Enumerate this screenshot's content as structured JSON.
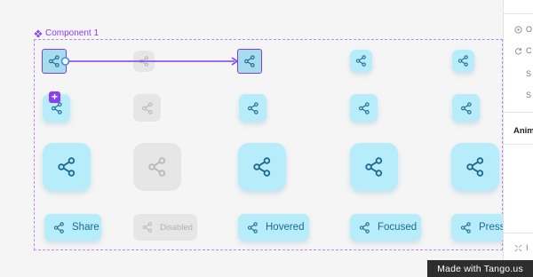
{
  "component": {
    "label": "Component 1"
  },
  "buttons": {
    "share": "Share",
    "disabled": "Disabled",
    "hovered": "Hovered",
    "focused": "Focused",
    "pressed": "Pressed"
  },
  "panel": {
    "row1": "O",
    "row2": "C",
    "row3": "S",
    "row4": "S",
    "animation": "Anim",
    "bottom": "I"
  },
  "watermark": "Made with Tango.us",
  "colors": {
    "button_bg": "#b7ecfa",
    "disabled_bg": "#e6e6e6",
    "icon": "#1e6b90",
    "accent": "#8b3ff2"
  },
  "icons": [
    "component-icon",
    "share-icon",
    "plus-icon",
    "target-icon",
    "refresh-icon",
    "collapse-icon"
  ]
}
